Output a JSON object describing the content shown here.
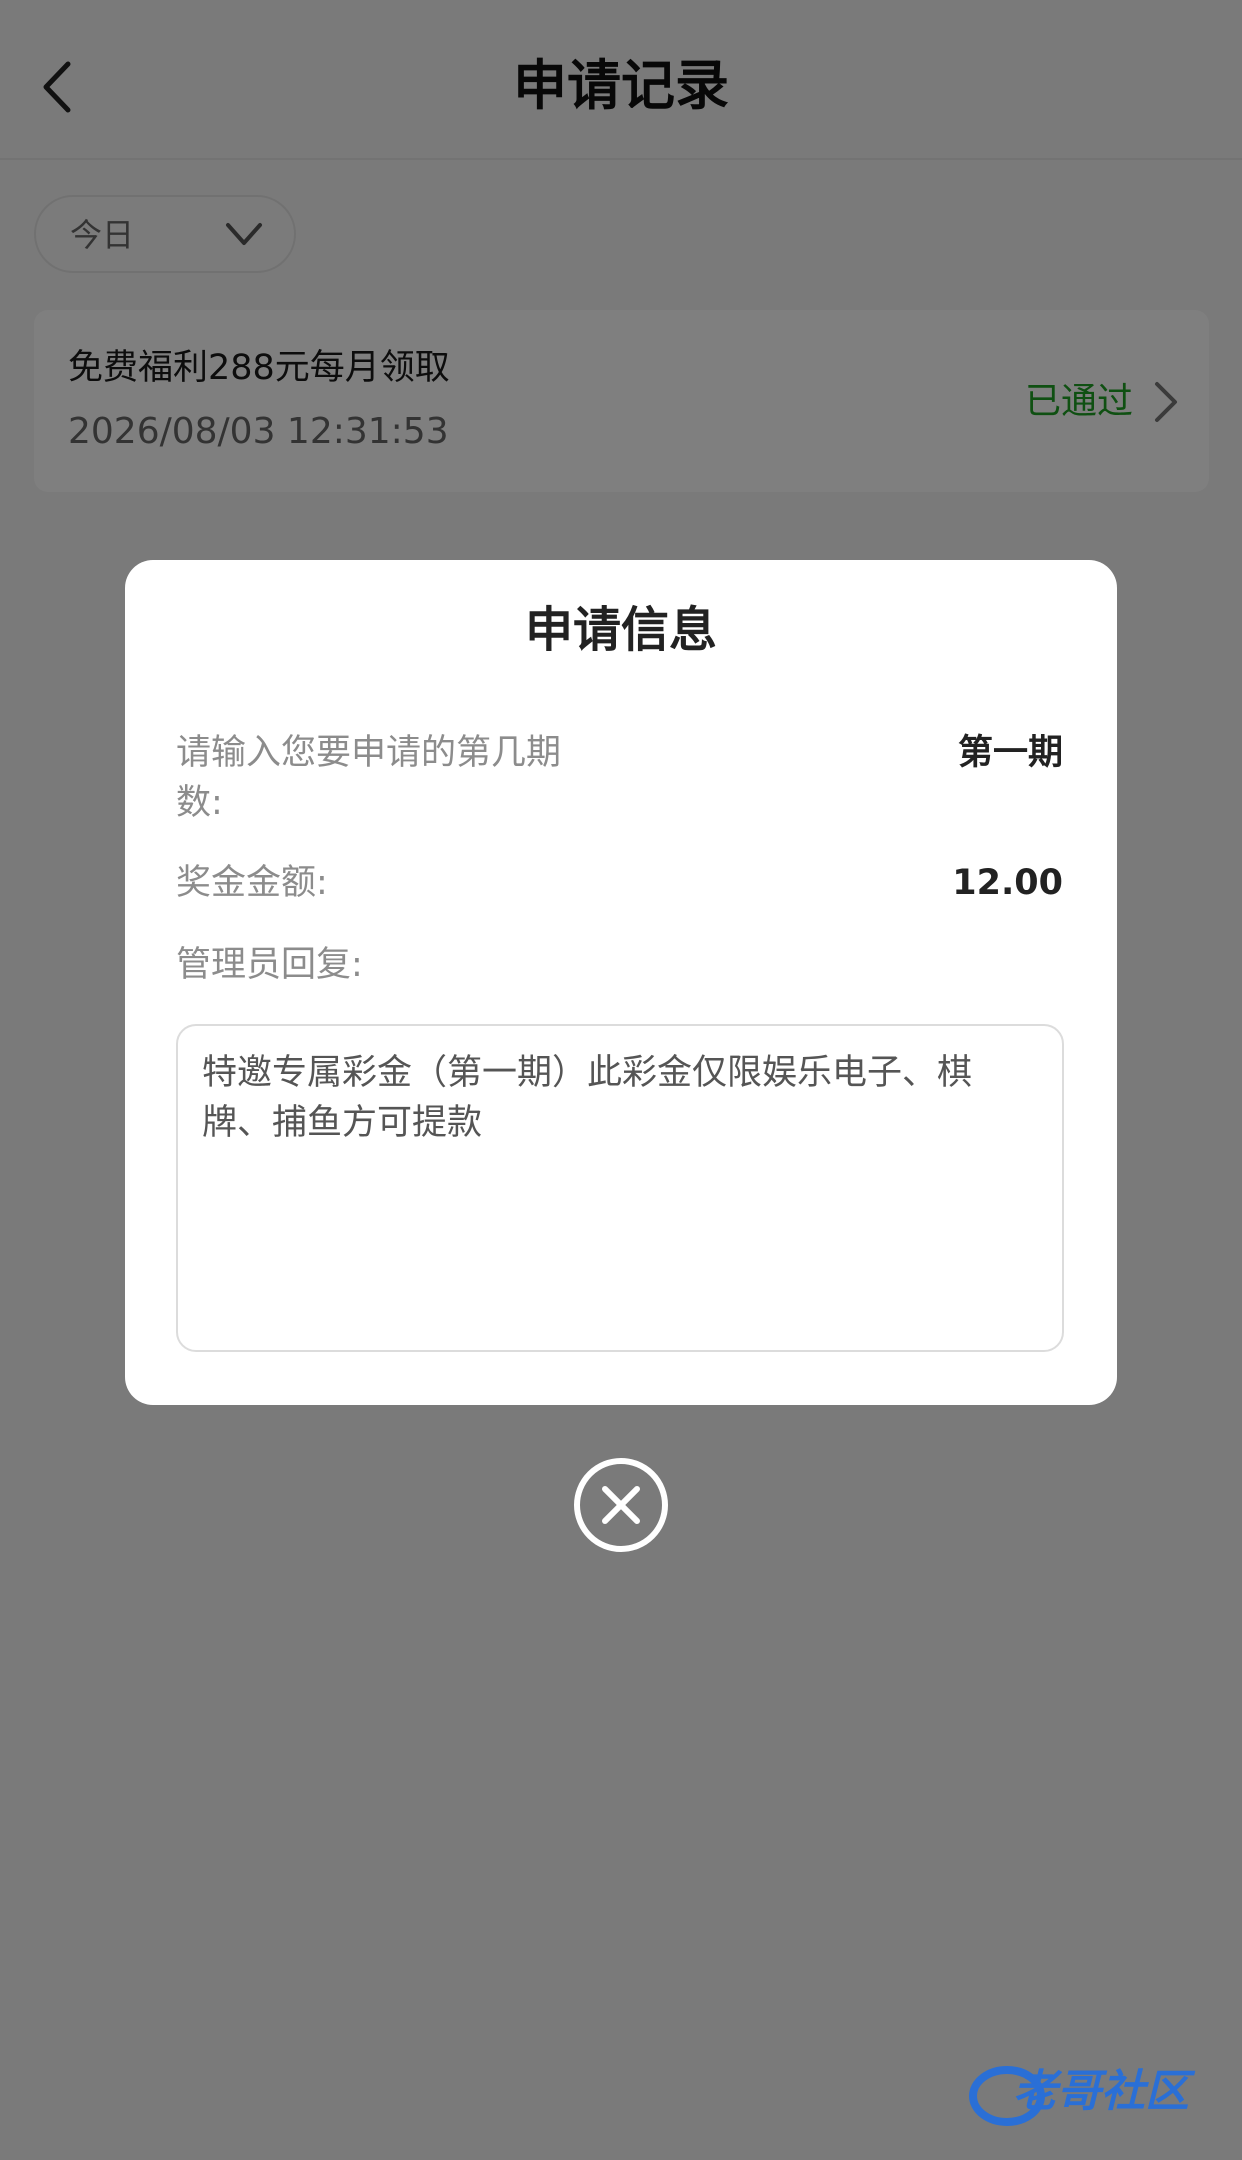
{
  "nav": {
    "title": "申请记录"
  },
  "filter": {
    "selected": "今日"
  },
  "record": {
    "title": "免费福利288元每月领取",
    "time": "2026/08/03 12:31:53",
    "status": "已通过",
    "status_color": "#1fa024"
  },
  "dialog": {
    "title": "申请信息",
    "period_label_line1": "请输入您要申请的第几期",
    "period_label_line2": "数:",
    "period_value": "第一期",
    "amount_label": "奖金金额:",
    "amount_value": "12.00",
    "reply_label": "管理员回复:",
    "reply_text": "特邀专属彩金（第一期）此彩金仅限娱乐电子、棋牌、捕鱼方可提款"
  },
  "watermark": {
    "text": "老哥社区"
  }
}
